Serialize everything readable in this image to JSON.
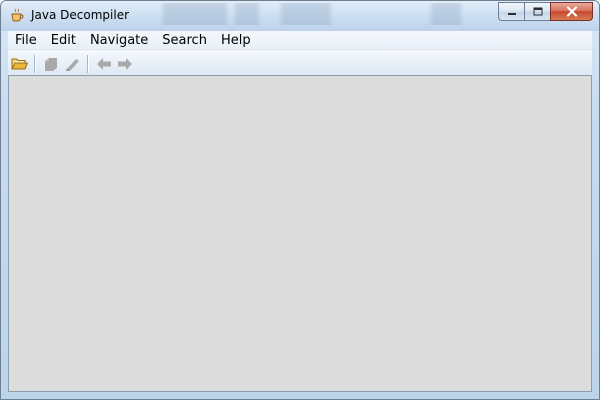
{
  "window": {
    "title": "Java Decompiler",
    "icon": "coffee-cup-icon"
  },
  "caption_buttons": {
    "minimize_icon": "minimize-icon",
    "maximize_icon": "maximize-icon",
    "close_icon": "close-icon"
  },
  "menu": {
    "items": [
      "File",
      "Edit",
      "Navigate",
      "Search",
      "Help"
    ]
  },
  "toolbar": {
    "buttons": [
      {
        "icon": "open-folder-icon",
        "enabled": true
      },
      {
        "icon": "save-icon",
        "enabled": false
      },
      {
        "icon": "edit-pencil-icon",
        "enabled": false
      },
      {
        "icon": "back-arrow-icon",
        "enabled": false
      },
      {
        "icon": "forward-arrow-icon",
        "enabled": false
      }
    ]
  },
  "colors": {
    "content_background": "#dcdcdc",
    "close_button": "#c44a2d",
    "disabled_icon": "#a9a9a9",
    "folder_icon": "#e8b63c"
  }
}
